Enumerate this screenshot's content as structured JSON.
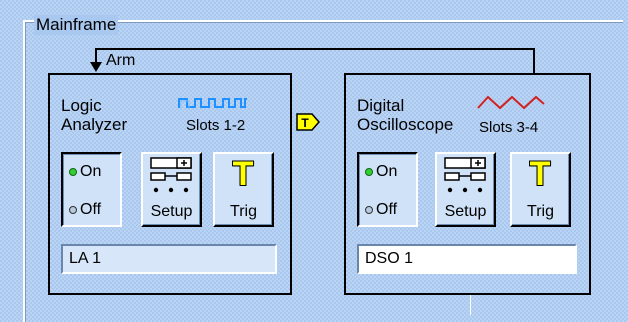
{
  "mainframe": {
    "label": "Mainframe",
    "arm_label": "Arm"
  },
  "modules": [
    {
      "title_line1": "Logic",
      "title_line2": "Analyzer",
      "slots": "Slots 1-2",
      "on_label": "On",
      "off_label": "Off",
      "setup_label": "Setup",
      "trig_label": "Trig",
      "trig_glyph": "T",
      "name_value": "LA 1",
      "signal_icon": "digital-square-wave-icon",
      "signal_color": "#1e90ff"
    },
    {
      "title_line1": "Digital",
      "title_line2": "Oscilloscope",
      "slots": "Slots 3-4",
      "on_label": "On",
      "off_label": "Off",
      "setup_label": "Setup",
      "trig_label": "Trig",
      "trig_glyph": "T",
      "name_value": "DSO 1",
      "signal_icon": "analog-sine-wave-icon",
      "signal_color": "#d22020"
    }
  ],
  "trigger_tag": {
    "glyph": "T",
    "color": "#ffff00"
  },
  "colors": {
    "background": "#a9c8ef",
    "led_on": "#2fd02f",
    "trig_yellow": "#ffff00"
  }
}
